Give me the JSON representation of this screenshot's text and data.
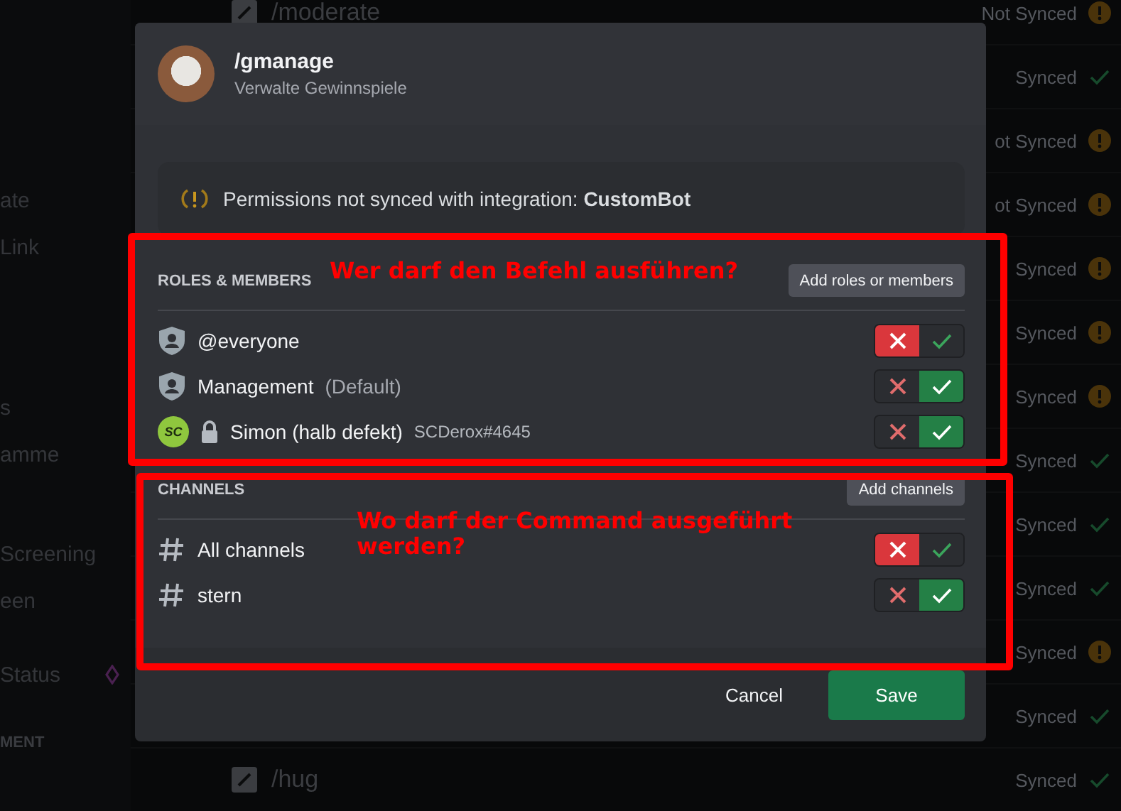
{
  "sidebar": {
    "items": [
      {
        "label": "ate",
        "kind": "item"
      },
      {
        "label": "Link",
        "kind": "item"
      },
      {
        "label": "s",
        "kind": "item"
      },
      {
        "label": "amme",
        "kind": "item"
      },
      {
        "label": "Screening",
        "kind": "item"
      },
      {
        "label": "een",
        "kind": "item"
      },
      {
        "label": "Status",
        "kind": "premium"
      },
      {
        "label": "MENT",
        "kind": "heading"
      }
    ]
  },
  "commands": [
    {
      "name": "/moderate",
      "status": "Not Synced",
      "synced": false
    },
    {
      "status": "Synced",
      "synced": true
    },
    {
      "status": "ot Synced",
      "synced": false
    },
    {
      "status": "ot Synced",
      "synced": false
    },
    {
      "status": "Synced",
      "synced": false
    },
    {
      "status": "Synced",
      "synced": false
    },
    {
      "status": "Synced",
      "synced": false
    },
    {
      "status": "Synced",
      "synced": true
    },
    {
      "status": "Synced",
      "synced": true
    },
    {
      "status": "Synced",
      "synced": true
    },
    {
      "status": "Synced",
      "synced": false
    },
    {
      "status": "Synced",
      "synced": true
    },
    {
      "name": "/hug",
      "status": "Synced",
      "synced": true
    }
  ],
  "modal": {
    "title": "/gmanage",
    "subtitle": "Verwalte Gewinnspiele",
    "notice": "Permissions not synced with integration: **CustomBot**",
    "roles": {
      "heading": "ROLES & MEMBERS",
      "add_button": "Add roles or members",
      "items": [
        {
          "kind": "role",
          "name": "@everyone",
          "allowed": false
        },
        {
          "kind": "role",
          "name": "Management",
          "note": "(Default)",
          "allowed": true
        },
        {
          "kind": "member",
          "avatar_text": "SC",
          "locked": true,
          "name": "Simon (halb defekt)",
          "tag": "SCDerox#4645",
          "allowed": true
        }
      ]
    },
    "channels": {
      "heading": "CHANNELS",
      "add_button": "Add channels",
      "items": [
        {
          "kind": "channel",
          "name": "All channels",
          "allowed": false
        },
        {
          "kind": "channel",
          "name": "stern",
          "allowed": true
        }
      ]
    },
    "cancel": "Cancel",
    "save": "Save"
  },
  "annotations": [
    {
      "text": "Wer darf den Befehl ausführen?"
    },
    {
      "text": "Wo darf der Command ausgeführt werden?"
    }
  ]
}
